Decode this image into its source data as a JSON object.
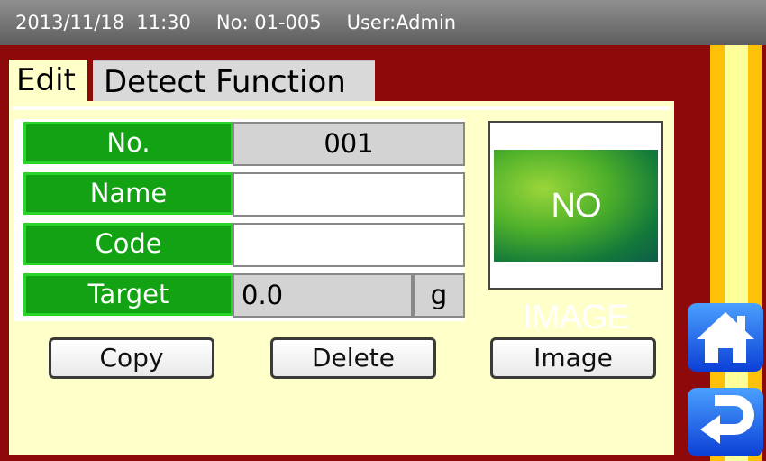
{
  "status": {
    "datetime": "2013/11/18  11:30",
    "number": "No: 01-005",
    "user": "User:Admin"
  },
  "tabs": [
    {
      "label": "Edit"
    },
    {
      "label": "Detect Function"
    }
  ],
  "form": {
    "no_label": "No.",
    "no_value": "001",
    "name_label": "Name",
    "name_value": "",
    "code_label": "Code",
    "code_value": "",
    "target_label": "Target",
    "target_value": "0.0",
    "target_unit": "g"
  },
  "image": {
    "placeholder": "NO IMAGE"
  },
  "buttons": {
    "copy": "Copy",
    "delete": "Delete",
    "image": "Image"
  },
  "nav": {
    "home_icon": "home-icon",
    "back_icon": "return-arrow-icon"
  },
  "colors": {
    "background": "#8e0a0a",
    "panel": "#ffffc9",
    "label_green": "#13a213",
    "nav_blue": "#1a5cf0",
    "stripe_orange": "#ffc107"
  }
}
